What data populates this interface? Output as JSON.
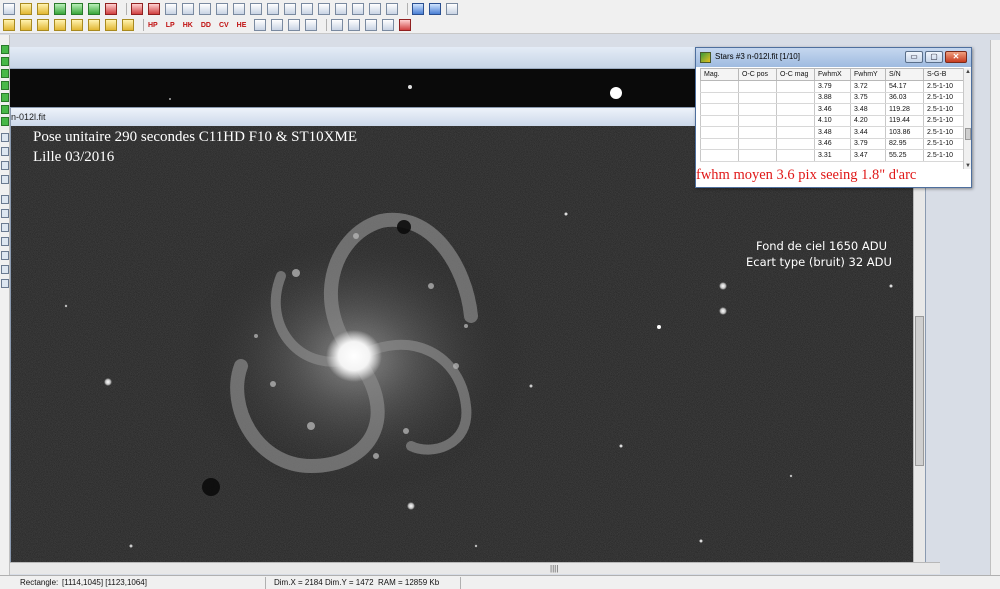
{
  "image_window": {
    "title": "n-012l.fit",
    "caption_line1": "Pose unitaire 290 secondes  C11HD F10 & ST10XME",
    "caption_line2": "Lille 03/2016",
    "sky_line1": "Fond de ciel 1650 ADU",
    "sky_line2": "Ecart type (bruit) 32 ADU"
  },
  "toolbar2_labels": [
    "HP",
    "LP",
    "HK",
    "DD",
    "CV",
    "HE"
  ],
  "stars_dialog": {
    "title": "Stars #3 n-012l.fit  [1/10]",
    "minimize_label": "▭",
    "maximize_label": "▢",
    "close_label": "✕",
    "columns": [
      "Mag.",
      "O-C pos",
      "O-C mag",
      "FwhmX",
      "FwhmY",
      "S/N",
      "S-G-B"
    ],
    "rows": [
      [
        "",
        "",
        "",
        "3.79",
        "3.72",
        "54.17",
        "2.5-1-10"
      ],
      [
        "",
        "",
        "",
        "3.88",
        "3.75",
        "36.03",
        "2.5-1-10"
      ],
      [
        "",
        "",
        "",
        "3.46",
        "3.48",
        "119.28",
        "2.5-1-10"
      ],
      [
        "",
        "",
        "",
        "4.10",
        "4.20",
        "119.44",
        "2.5-1-10"
      ],
      [
        "",
        "",
        "",
        "3.48",
        "3.44",
        "103.86",
        "2.5-1-10"
      ],
      [
        "",
        "",
        "",
        "3.46",
        "3.79",
        "82.95",
        "2.5-1-10"
      ],
      [
        "",
        "",
        "",
        "3.31",
        "3.47",
        "55.25",
        "2.5-1-10"
      ]
    ],
    "annotation": "fwhm moyen 3.6 pix    seeing 1.8\" d'arc"
  },
  "h_scroll": {
    "grip": "||||"
  },
  "status_bar": {
    "selection_label": "Rectangle:",
    "selection_value": "[1114,1045] [1123,1064]",
    "dim_x": "Dim.X = 2184",
    "dim_y": "Dim.Y = 1472",
    "ram": "RAM = 12859 Kb"
  }
}
